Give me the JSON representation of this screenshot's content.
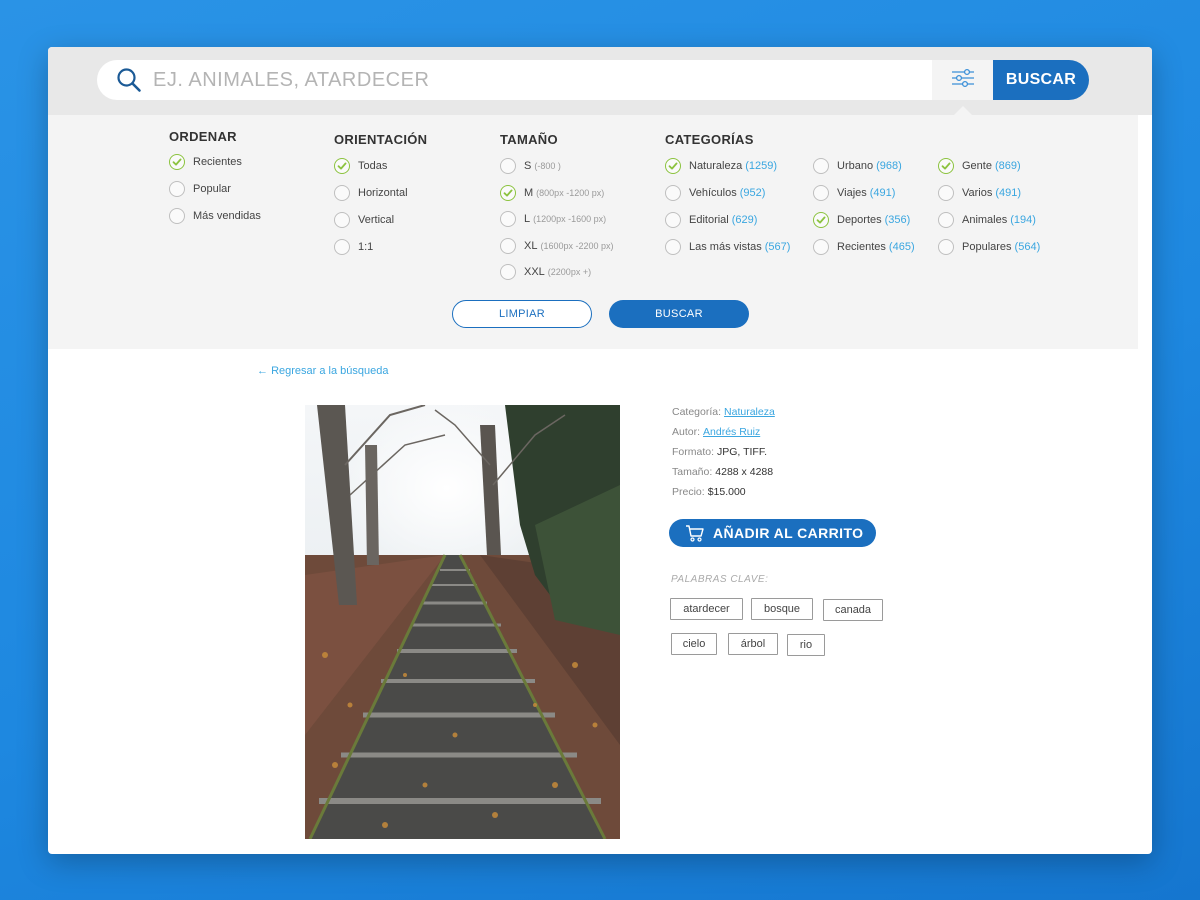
{
  "search": {
    "placeholder": "EJ. ANIMALES, ATARDECER",
    "button_label": "BUSCAR"
  },
  "filters": {
    "ordenar": {
      "title": "ORDENAR",
      "options": [
        {
          "label": "Recientes",
          "checked": true
        },
        {
          "label": "Popular",
          "checked": false
        },
        {
          "label": "Más vendidas",
          "checked": false
        }
      ]
    },
    "orientacion": {
      "title": "ORIENTACIÓN",
      "options": [
        {
          "label": "Todas",
          "checked": true
        },
        {
          "label": "Horizontal",
          "checked": false
        },
        {
          "label": "Vertical",
          "checked": false
        },
        {
          "label": "1:1",
          "checked": false
        }
      ]
    },
    "tamano": {
      "title": "TAMAÑO",
      "options": [
        {
          "label": "S",
          "sub": "(-800 )",
          "checked": false
        },
        {
          "label": "M",
          "sub": "(800px -1200 px)",
          "checked": true
        },
        {
          "label": "L",
          "sub": "(1200px -1600 px)",
          "checked": false
        },
        {
          "label": "XL",
          "sub": "(1600px -2200 px)",
          "checked": false
        },
        {
          "label": "XXL",
          "sub": "(2200px +)",
          "checked": false
        }
      ]
    },
    "categorias": {
      "title": "CATEGORÍAS",
      "options": [
        {
          "label": "Naturaleza",
          "count": "(1259)",
          "checked": true
        },
        {
          "label": "Vehículos",
          "count": "(952)",
          "checked": false
        },
        {
          "label": "Editorial",
          "count": "(629)",
          "checked": false
        },
        {
          "label": "Las más vistas",
          "count": "(567)",
          "checked": false
        },
        {
          "label": "Urbano",
          "count": "(968)",
          "checked": false
        },
        {
          "label": "Viajes",
          "count": "(491)",
          "checked": false
        },
        {
          "label": "Deportes",
          "count": "(356)",
          "checked": true
        },
        {
          "label": "Recientes",
          "count": "(465)",
          "checked": false
        },
        {
          "label": "Gente",
          "count": "(869)",
          "checked": true
        },
        {
          "label": "Varios",
          "count": "(491)",
          "checked": false
        },
        {
          "label": "Animales",
          "count": "(194)",
          "checked": false
        },
        {
          "label": "Populares",
          "count": "(564)",
          "checked": false
        }
      ]
    },
    "clear_label": "LIMPIAR",
    "search_label": "BUSCAR"
  },
  "detail": {
    "back_label": "Regresar a la búsqueda",
    "meta": {
      "category_label": "Categoría:",
      "category_value": "Naturaleza",
      "author_label": "Autor:",
      "author_value": "Andrés Ruiz",
      "format_label": "Formato:",
      "format_value": "JPG, TIFF.",
      "size_label": "Tamaño:",
      "size_value": "4288 x 4288",
      "price_label": "Precio:",
      "price_value": "$15.000"
    },
    "cart_label": "AÑADIR AL CARRITO",
    "keywords_title": "PALABRAS CLAVE:",
    "keywords": [
      "atardecer",
      "bosque",
      "canada",
      "cielo",
      "árbol",
      "rio"
    ]
  },
  "colors": {
    "primary": "#1b6fbf",
    "link": "#3aa6e0",
    "check": "#8cc33f",
    "background": "#1e88e0"
  }
}
